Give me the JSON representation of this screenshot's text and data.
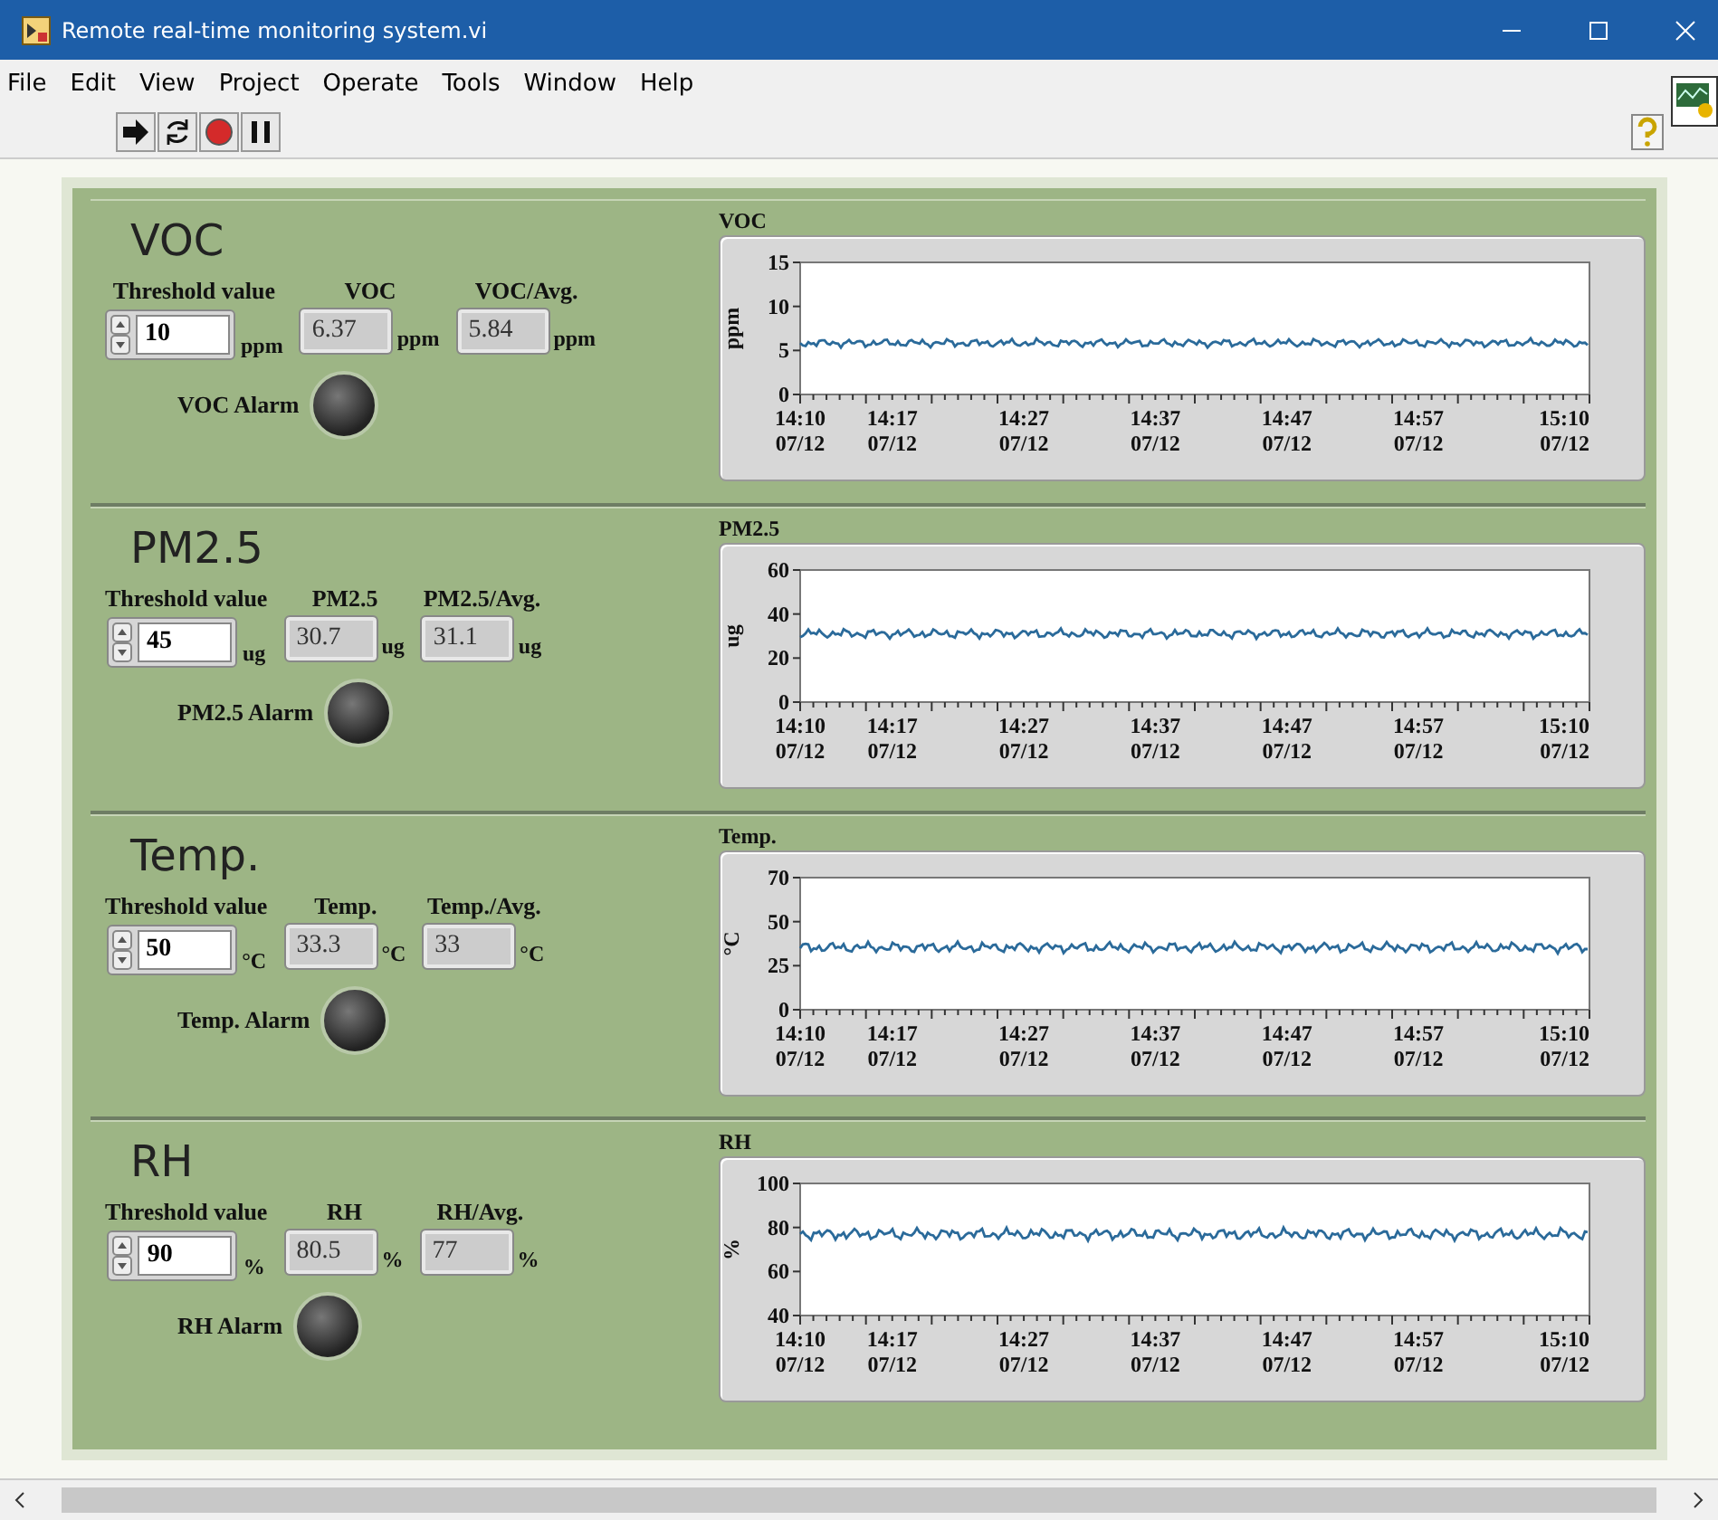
{
  "window": {
    "title": "Remote real-time monitoring system.vi"
  },
  "menu": [
    "File",
    "Edit",
    "View",
    "Project",
    "Operate",
    "Tools",
    "Window",
    "Help"
  ],
  "panels": [
    {
      "title": "VOC",
      "threshold": {
        "label": "Threshold value",
        "value": "10",
        "unit": "ppm"
      },
      "readings": [
        {
          "label": "VOC",
          "value": "6.37",
          "unit": "ppm"
        },
        {
          "label": "VOC/Avg.",
          "value": "5.84",
          "unit": "ppm"
        }
      ],
      "alarm": {
        "label": "VOC Alarm",
        "on": false
      },
      "chart": {
        "title": "VOC",
        "ylabel": "ppm",
        "yticks": [
          "15",
          "10",
          "5",
          "0"
        ],
        "xticks": [
          {
            "time": "14:10",
            "date": "07/12"
          },
          {
            "time": "14:17",
            "date": "07/12"
          },
          {
            "time": "14:27",
            "date": "07/12"
          },
          {
            "time": "14:37",
            "date": "07/12"
          },
          {
            "time": "14:47",
            "date": "07/12"
          },
          {
            "time": "14:57",
            "date": "07/12"
          },
          {
            "time": "15:10",
            "date": "07/12"
          }
        ]
      }
    },
    {
      "title": "PM2.5",
      "threshold": {
        "label": "Threshold value",
        "value": "45",
        "unit": "ug"
      },
      "readings": [
        {
          "label": "PM2.5",
          "value": "30.7",
          "unit": "ug"
        },
        {
          "label": "PM2.5/Avg.",
          "value": "31.1",
          "unit": "ug"
        }
      ],
      "alarm": {
        "label": "PM2.5 Alarm",
        "on": false
      },
      "chart": {
        "title": "PM2.5",
        "ylabel": "ug",
        "yticks": [
          "60",
          "40",
          "20",
          "0"
        ],
        "xticks": [
          {
            "time": "14:10",
            "date": "07/12"
          },
          {
            "time": "14:17",
            "date": "07/12"
          },
          {
            "time": "14:27",
            "date": "07/12"
          },
          {
            "time": "14:37",
            "date": "07/12"
          },
          {
            "time": "14:47",
            "date": "07/12"
          },
          {
            "time": "14:57",
            "date": "07/12"
          },
          {
            "time": "15:10",
            "date": "07/12"
          }
        ]
      }
    },
    {
      "title": "Temp.",
      "threshold": {
        "label": "Threshold value",
        "value": "50",
        "unit": "°C"
      },
      "readings": [
        {
          "label": "Temp.",
          "value": "33.3",
          "unit": "°C"
        },
        {
          "label": "Temp./Avg.",
          "value": "33",
          "unit": "°C"
        }
      ],
      "alarm": {
        "label": "Temp. Alarm",
        "on": false
      },
      "chart": {
        "title": "Temp.",
        "ylabel": "°C",
        "yticks": [
          "70",
          "50",
          "25",
          "0"
        ],
        "xticks": [
          {
            "time": "14:10",
            "date": "07/12"
          },
          {
            "time": "14:17",
            "date": "07/12"
          },
          {
            "time": "14:27",
            "date": "07/12"
          },
          {
            "time": "14:37",
            "date": "07/12"
          },
          {
            "time": "14:47",
            "date": "07/12"
          },
          {
            "time": "14:57",
            "date": "07/12"
          },
          {
            "time": "15:10",
            "date": "07/12"
          }
        ]
      }
    },
    {
      "title": "RH",
      "threshold": {
        "label": "Threshold value",
        "value": "90",
        "unit": "%"
      },
      "readings": [
        {
          "label": "RH",
          "value": "80.5",
          "unit": "%"
        },
        {
          "label": "RH/Avg.",
          "value": "77",
          "unit": "%"
        }
      ],
      "alarm": {
        "label": "RH Alarm",
        "on": false
      },
      "chart": {
        "title": "RH",
        "ylabel": "%",
        "yticks": [
          "100",
          "80",
          "60",
          "40"
        ],
        "xticks": [
          {
            "time": "14:10",
            "date": "07/12"
          },
          {
            "time": "14:17",
            "date": "07/12"
          },
          {
            "time": "14:27",
            "date": "07/12"
          },
          {
            "time": "14:37",
            "date": "07/12"
          },
          {
            "time": "14:47",
            "date": "07/12"
          },
          {
            "time": "14:57",
            "date": "07/12"
          },
          {
            "time": "15:10",
            "date": "07/12"
          }
        ]
      }
    }
  ]
}
